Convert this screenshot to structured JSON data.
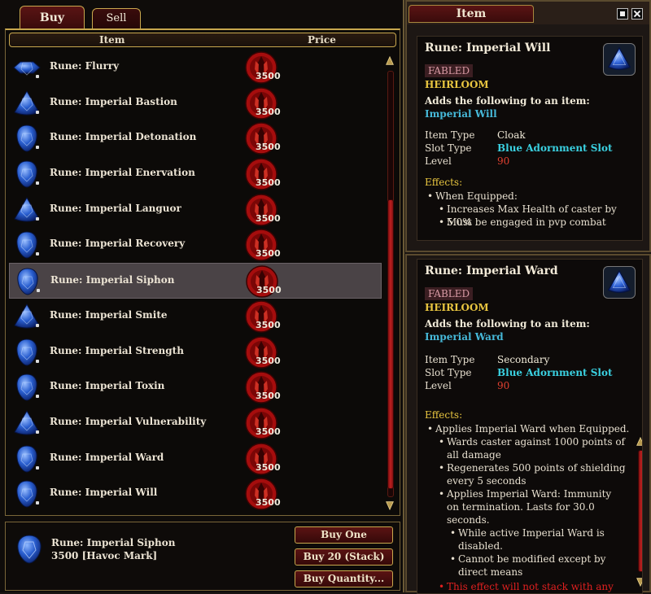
{
  "merchant": {
    "tabs": {
      "buy": "Buy",
      "sell": "Sell"
    },
    "columns": {
      "item": "Item",
      "price": "Price"
    },
    "items": [
      {
        "name": "Rune: Flurry",
        "price": "3500"
      },
      {
        "name": "Rune: Imperial Bastion",
        "price": "3500"
      },
      {
        "name": "Rune: Imperial Detonation",
        "price": "3500"
      },
      {
        "name": "Rune: Imperial Enervation",
        "price": "3500"
      },
      {
        "name": "Rune: Imperial Languor",
        "price": "3500"
      },
      {
        "name": "Rune: Imperial Recovery",
        "price": "3500"
      },
      {
        "name": "Rune: Imperial Siphon",
        "price": "3500"
      },
      {
        "name": "Rune: Imperial Smite",
        "price": "3500"
      },
      {
        "name": "Rune: Imperial Strength",
        "price": "3500"
      },
      {
        "name": "Rune: Imperial Toxin",
        "price": "3500"
      },
      {
        "name": "Rune: Imperial Vulnerability",
        "price": "3500"
      },
      {
        "name": "Rune: Imperial Ward",
        "price": "3500"
      },
      {
        "name": "Rune: Imperial Will",
        "price": "3500"
      }
    ],
    "selected_index": 6,
    "selected": {
      "name": "Rune: Imperial Siphon",
      "price_text": "3500 [Havoc Mark]"
    },
    "buttons": {
      "buy_one": "Buy One",
      "buy_stack": "Buy 20 (Stack)",
      "buy_quantity": "Buy Quantity..."
    }
  },
  "item_window": {
    "title": "Item",
    "card1": {
      "name": "Rune: Imperial Will",
      "tier": "FABLED",
      "flag": "HEIRLOOM",
      "adds_label": "Adds the following to an item:",
      "adds_item": "Imperial Will",
      "stats": [
        {
          "key": "Item Type",
          "value": "Cloak"
        },
        {
          "key": "Slot Type",
          "value": "Blue Adornment Slot"
        },
        {
          "key": "Level",
          "value": "90"
        }
      ],
      "effects_label": "Effects:",
      "effects": [
        "When Equipped:",
        "Increases Max Health of caster by 5.0%",
        "Must be engaged in pvp combat"
      ]
    },
    "card2": {
      "name": "Rune: Imperial Ward",
      "tier": "FABLED",
      "flag": "HEIRLOOM",
      "adds_label": "Adds the following to an item:",
      "adds_item": "Imperial Ward",
      "stats": [
        {
          "key": "Item Type",
          "value": "Secondary"
        },
        {
          "key": "Slot Type",
          "value": "Blue Adornment Slot"
        },
        {
          "key": "Level",
          "value": "90"
        }
      ],
      "effects_label": "Effects:",
      "effects": [
        "Applies Imperial Ward when Equipped.",
        "Wards caster against 1000 points of",
        "all damage",
        "Regenerates 500 points of shielding",
        "every 5 seconds",
        "Applies Imperial Ward: Immunity",
        "on termination.  Lasts for 30.0",
        "seconds.",
        "While active Imperial Ward is",
        "disabled.",
        "Cannot be modified except by",
        "direct means",
        "This effect will not stack with any"
      ]
    }
  },
  "colors": {
    "gold_border": "#c8a84e",
    "tab_red": "#5a1414",
    "fabled": "#d89aa4",
    "heirloom": "#e9c640",
    "link": "#46b8d8",
    "slot": "#3ad0e0",
    "level": "#e04030"
  },
  "icons": [
    "blue-rune-gem-icon",
    "havoc-mark-coin-icon",
    "scroll-up-arrow-icon",
    "scroll-down-arrow-icon",
    "window-pin-icon",
    "window-close-icon"
  ]
}
